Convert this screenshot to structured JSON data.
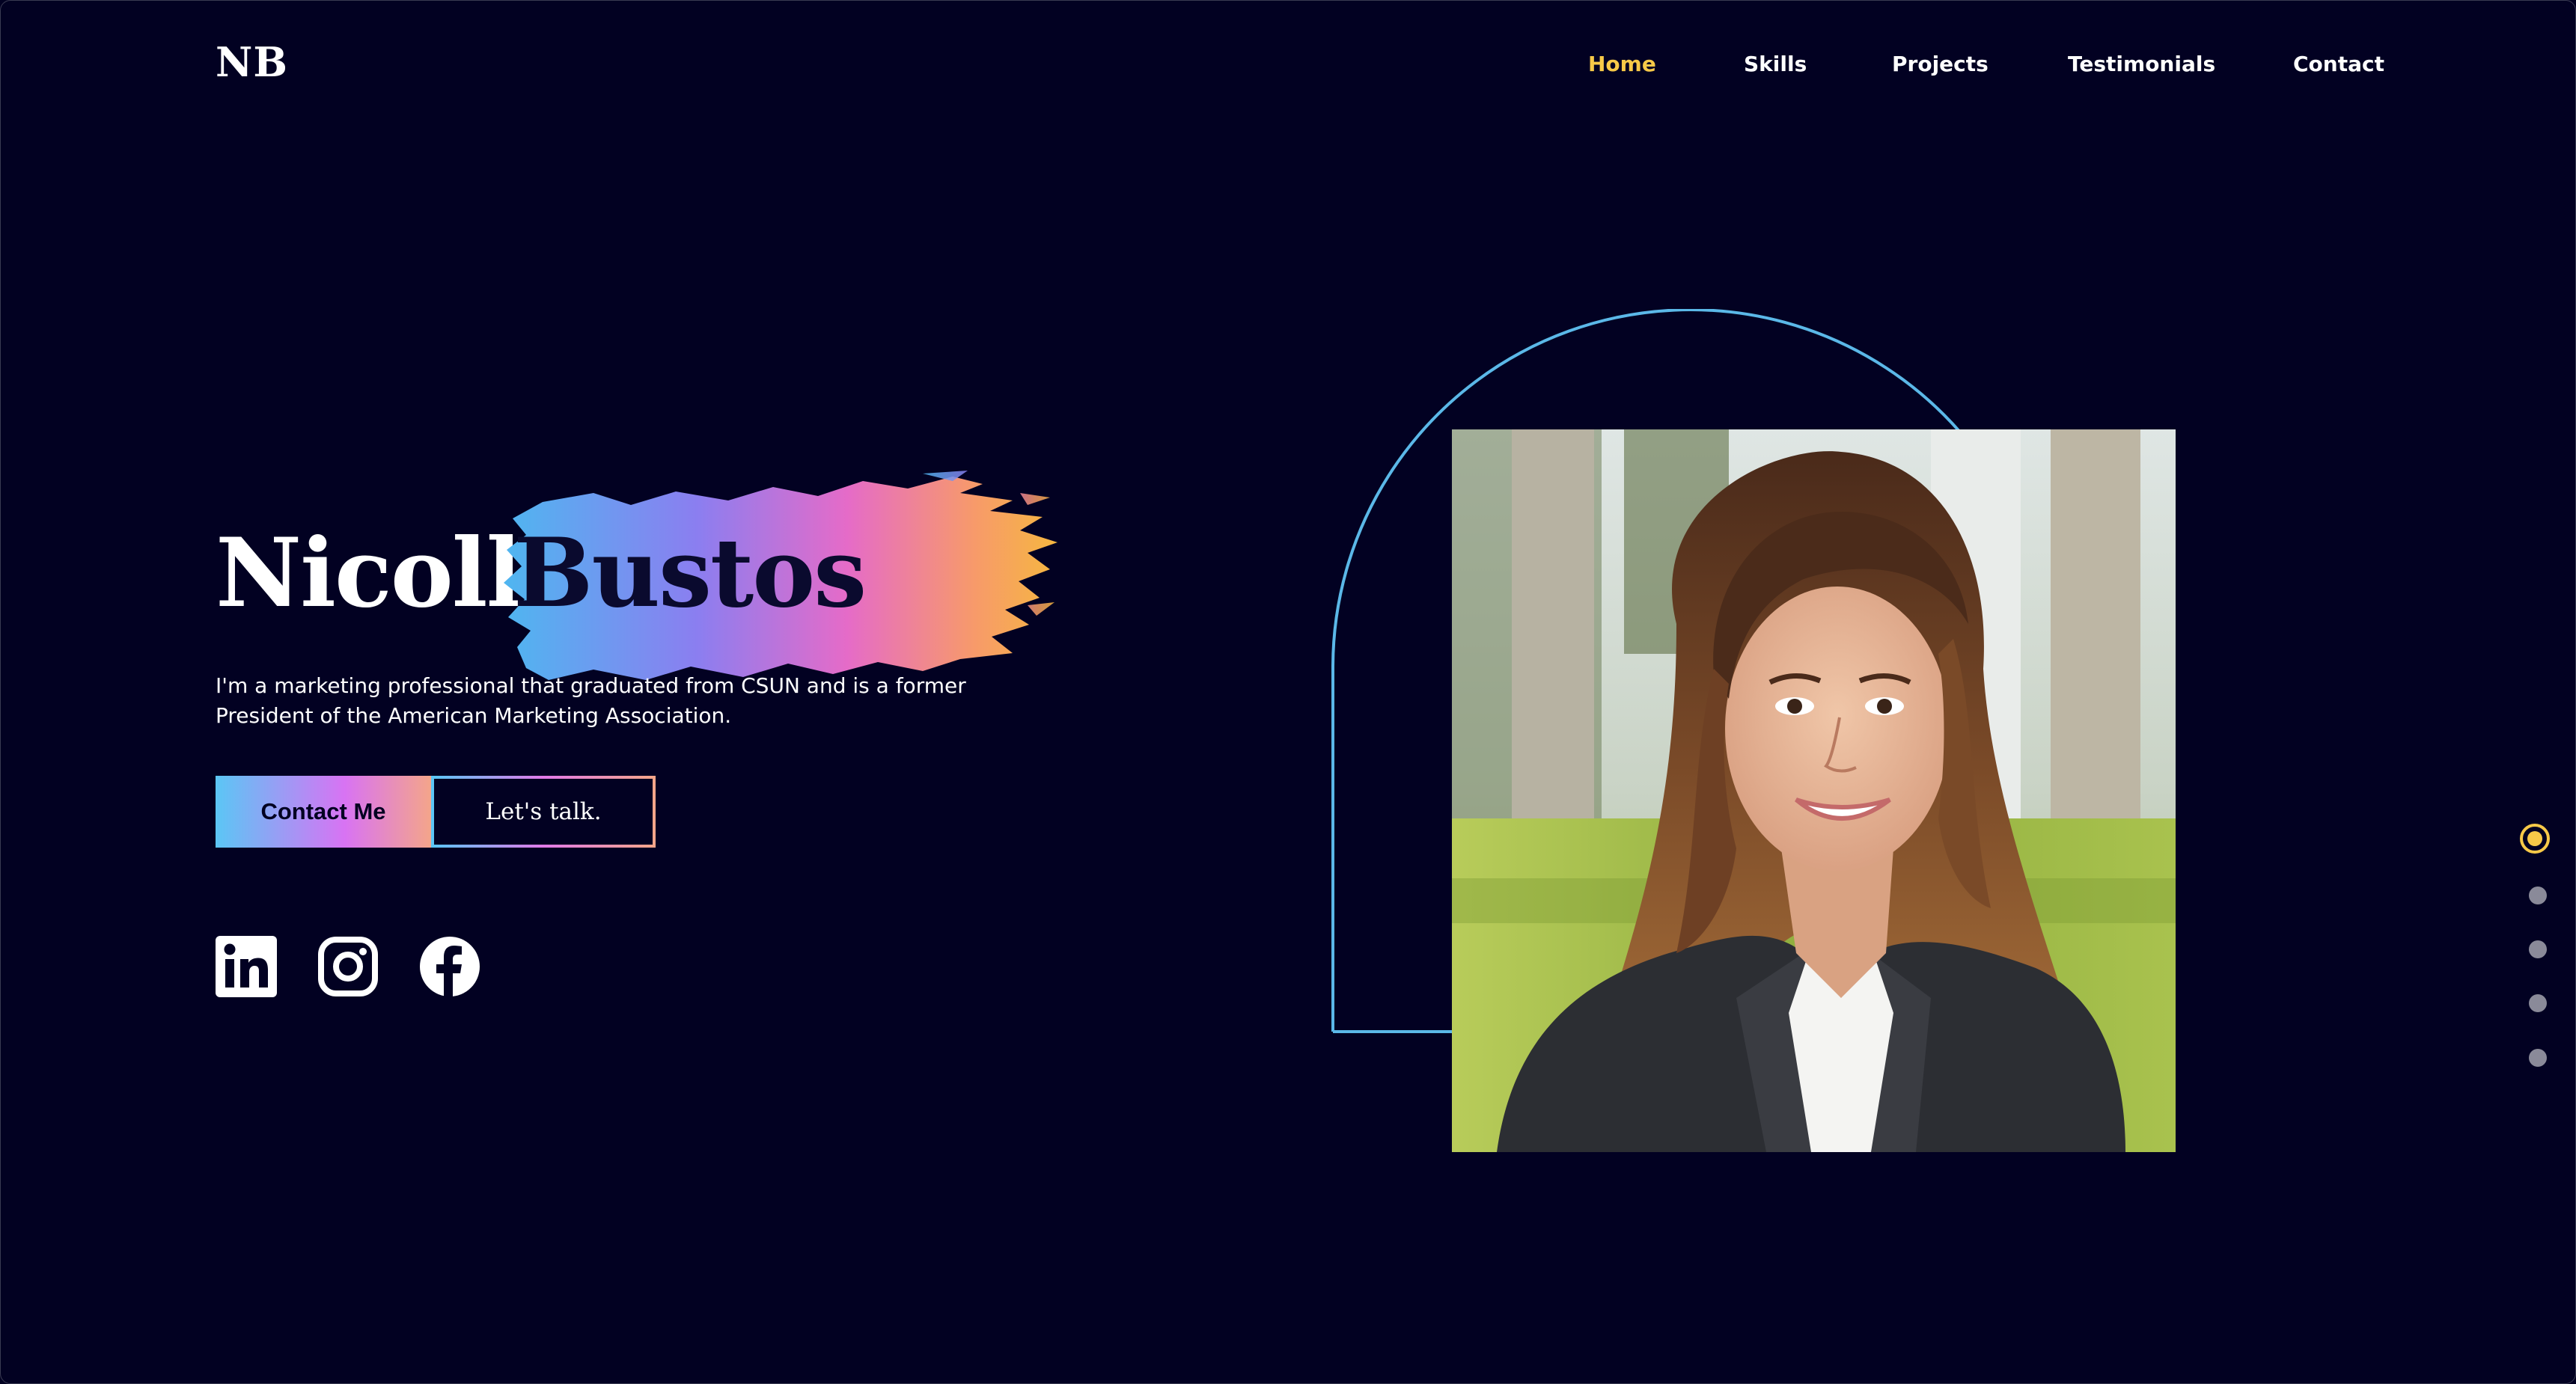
{
  "header": {
    "logo": "NB",
    "nav": [
      {
        "label": "Home",
        "active": true
      },
      {
        "label": "Skills",
        "active": false
      },
      {
        "label": "Projects",
        "active": false
      },
      {
        "label": "Testimonials",
        "active": false
      },
      {
        "label": "Contact",
        "active": false
      }
    ]
  },
  "hero": {
    "first_name": "Nicolle",
    "last_name": "Bustos",
    "tagline": "I'm a marketing professional that graduated from CSUN and is a former President of the American Marketing Association.",
    "primary_button": "Contact Me",
    "secondary_button": "Let's talk.",
    "socials": [
      "linkedin-icon",
      "instagram-icon",
      "facebook-icon"
    ]
  },
  "side_nav": {
    "count": 5,
    "active_index": 0
  },
  "colors": {
    "background": "#020122",
    "accent": "#f7c948",
    "arch_stroke": "#5bb8e8",
    "gradient": [
      "#5bc6f5",
      "#d873f3",
      "#f4a58a"
    ]
  }
}
